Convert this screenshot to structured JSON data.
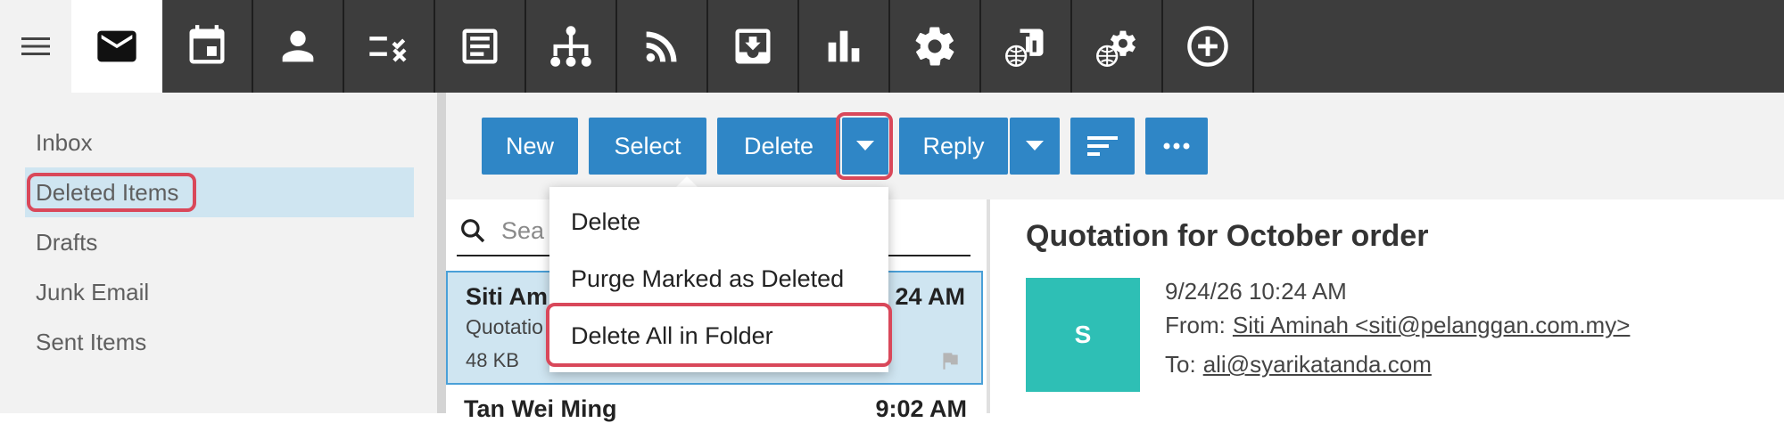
{
  "nav": {
    "apps": [
      {
        "name": "mail-icon",
        "active": true
      },
      {
        "name": "calendar-icon"
      },
      {
        "name": "contacts-icon"
      },
      {
        "name": "tasks-icon"
      },
      {
        "name": "notes-icon"
      },
      {
        "name": "org-chart-icon"
      },
      {
        "name": "rss-icon"
      },
      {
        "name": "inbox-download-icon"
      },
      {
        "name": "bar-chart-icon"
      },
      {
        "name": "settings-icon"
      },
      {
        "name": "web-report-icon"
      },
      {
        "name": "web-settings-icon"
      },
      {
        "name": "add-circle-icon"
      }
    ]
  },
  "sidebar": {
    "folders": [
      {
        "label": "Inbox"
      },
      {
        "label": "Deleted Items",
        "selected": true
      },
      {
        "label": "Drafts"
      },
      {
        "label": "Junk Email"
      },
      {
        "label": "Sent Items"
      }
    ]
  },
  "toolbar": {
    "new_label": "New",
    "select_label": "Select",
    "delete_label": "Delete",
    "reply_label": "Reply"
  },
  "delete_menu": {
    "items": [
      {
        "label": "Delete"
      },
      {
        "label": "Purge Marked as Deleted"
      },
      {
        "label": "Delete All in Folder"
      }
    ]
  },
  "search": {
    "placeholder": "Sea"
  },
  "messages": [
    {
      "sender": "Siti Am",
      "time": "24 AM",
      "subject": "Quotatio",
      "size": "48 KB",
      "selected": true
    },
    {
      "sender": "Tan Wei Ming",
      "time": "9:02 AM"
    }
  ],
  "reading_pane": {
    "title": "Quotation for October order",
    "avatar_initial": "S",
    "datetime": "9/24/26 10:24 AM",
    "from_label": "From:",
    "from_value": "Siti Aminah <siti@pelanggan.com.my>",
    "to_label": "To:",
    "to_value": "ali@syarikatanda.com"
  },
  "colors": {
    "accent": "#2f86c6",
    "highlight": "#d9485a",
    "selected_bg": "#cfe5f1",
    "avatar": "#2ebfb5",
    "topbar": "#3d3d3d"
  }
}
